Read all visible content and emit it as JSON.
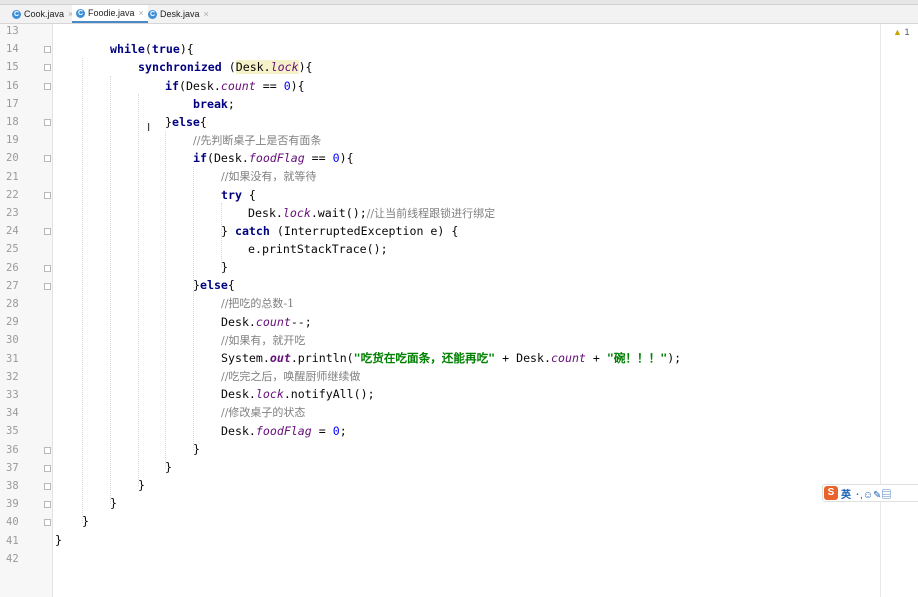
{
  "tabs": [
    {
      "label": "Cook.java",
      "icon": "java-class-icon",
      "active": false
    },
    {
      "label": "Foodie.java",
      "icon": "java-class-icon",
      "active": true
    },
    {
      "label": "Desk.java",
      "icon": "java-class-icon",
      "active": false
    }
  ],
  "tab_close_glyph": "×",
  "tab_icon_glyph": "C",
  "inspection": {
    "icon": "warning-icon",
    "glyph": "▲",
    "count": "1"
  },
  "ime": {
    "logo": "S",
    "mode": "英",
    "icons": "･,☺✎▤"
  },
  "text_cursor": "I",
  "line_numbers": [
    "13",
    "14",
    "15",
    "16",
    "17",
    "18",
    "19",
    "20",
    "21",
    "22",
    "23",
    "24",
    "25",
    "26",
    "27",
    "28",
    "29",
    "30",
    "31",
    "32",
    "33",
    "34",
    "35",
    "36",
    "37",
    "38",
    "39",
    "40",
    "41",
    "42"
  ],
  "code": {
    "l14": {
      "kw": "while",
      "a": "(",
      "b": "true",
      "c": "){"
    },
    "l15": {
      "kw": "synchronized",
      "a": " (",
      "cls": "Desk",
      "dot": ".",
      "f": "lock",
      "c": "){"
    },
    "l16": {
      "kw": "if",
      "a": "(Desk.",
      "f": "count",
      "b": " == ",
      "n": "0",
      "c": "){"
    },
    "l17": {
      "kw": "break",
      "c": ";"
    },
    "l18": {
      "a": "}",
      "kw": "else",
      "c": "{"
    },
    "l19": {
      "cm": "//先判断桌子上是否有面条"
    },
    "l20": {
      "kw": "if",
      "a": "(Desk.",
      "f": "foodFlag",
      "b": " == ",
      "n": "0",
      "c": "){"
    },
    "l21": {
      "cm": "//如果没有，就等待"
    },
    "l22": {
      "kw": "try",
      "c": " {"
    },
    "l23": {
      "a": "Desk.",
      "f": "lock",
      "b": ".wait();",
      "cm": "//让当前线程跟锁进行绑定"
    },
    "l24": {
      "a": "} ",
      "kw": "catch",
      "c": " (InterruptedException e) {"
    },
    "l25": {
      "a": "e.printStackTrace();"
    },
    "l26": {
      "a": "}"
    },
    "l27": {
      "a": "}",
      "kw": "else",
      "c": "{"
    },
    "l28": {
      "cm": "//把吃的总数-1"
    },
    "l29": {
      "a": "Desk.",
      "f": "count",
      "c": "--;"
    },
    "l30": {
      "cm": "//如果有，就开吃"
    },
    "l31": {
      "a": "System.",
      "f": "out",
      "b": ".println(",
      "s1": "\"吃货在吃面条，还能再吃\"",
      "m": " + Desk.",
      "f2": "count",
      "m2": " + ",
      "s2": "\"碗！！！\"",
      "c": ");"
    },
    "l32": {
      "cm": "//吃完之后，唤醒厨师继续做"
    },
    "l33": {
      "a": "Desk.",
      "f": "lock",
      "c": ".notifyAll();"
    },
    "l34": {
      "cm": "//修改桌子的状态"
    },
    "l35": {
      "a": "Desk.",
      "f": "foodFlag",
      "b": " = ",
      "n": "0",
      "c": ";"
    },
    "l36": {
      "a": "}"
    },
    "l37": {
      "a": "}"
    },
    "l38": {
      "a": "}"
    },
    "l39": {
      "a": "}"
    },
    "l40": {
      "a": "}"
    },
    "l41": {
      "a": "}"
    }
  }
}
